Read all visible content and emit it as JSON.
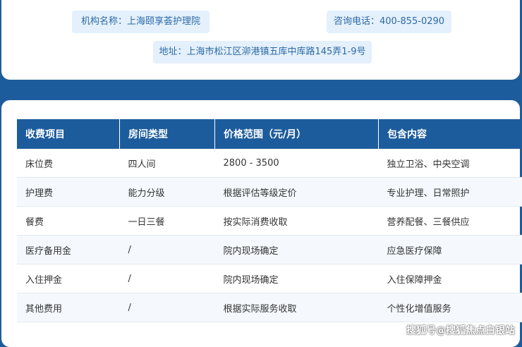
{
  "info": {
    "name": "机构名称：上海颐享荟护理院",
    "phone": "咨询电话：400-855-0290",
    "address": "地址：上海市松江区泖港镇五库中库路145弄1-9号"
  },
  "table": {
    "headers": [
      "收费项目",
      "房间类型",
      "价格范围（元/月）",
      "包含内容"
    ],
    "rows": [
      [
        "床位费",
        "四人间",
        "2800 - 3500",
        "独立卫浴、中央空调"
      ],
      [
        "护理费",
        "能力分级",
        "根据评估等级定价",
        "专业护理、日常照护"
      ],
      [
        "餐费",
        "一日三餐",
        "按实际消费收取",
        "营养配餐、三餐供应"
      ],
      [
        "医疗备用金",
        "/",
        "院内现场确定",
        "应急医疗保障"
      ],
      [
        "入住押金",
        "/",
        "院内现场确定",
        "入住保障押金"
      ],
      [
        "其他费用",
        "/",
        "根据实际服务收取",
        "个性化增值服务"
      ]
    ]
  },
  "watermark": "搜狐号@搜狐焦点白银站",
  "colors": {
    "brand_blue": "#1d5c9c",
    "pill_bg": "#e4f0fb",
    "pill_text": "#2c6aa7"
  }
}
